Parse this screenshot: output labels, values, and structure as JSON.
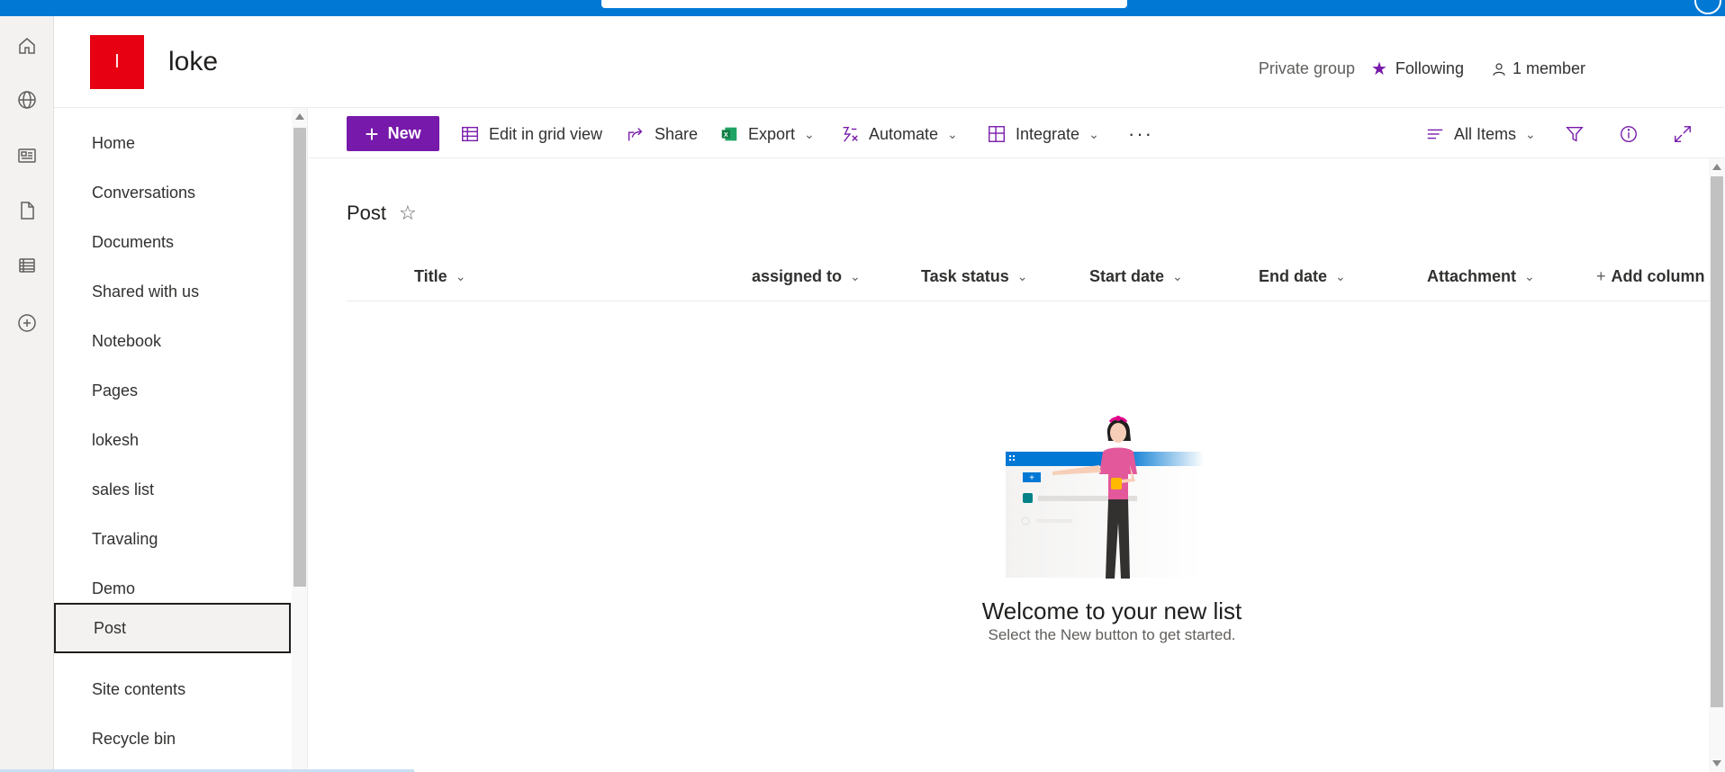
{
  "site": {
    "logo_letter": "l",
    "title": "loke",
    "privacy": "Private group",
    "following_label": "Following",
    "members_label": "1 member"
  },
  "rail": [
    "home-icon",
    "globe-icon",
    "news-icon",
    "document-icon",
    "list-icon",
    "add-circle-icon"
  ],
  "nav": {
    "items": [
      {
        "label": "Home"
      },
      {
        "label": "Conversations"
      },
      {
        "label": "Documents"
      },
      {
        "label": "Shared with us"
      },
      {
        "label": "Notebook"
      },
      {
        "label": "Pages"
      },
      {
        "label": "lokesh"
      },
      {
        "label": "sales list"
      },
      {
        "label": "Travaling"
      },
      {
        "label": "Demo"
      },
      {
        "label": "Post"
      },
      {
        "label": "Site contents"
      },
      {
        "label": "Recycle bin"
      }
    ],
    "selected": "Post"
  },
  "commands": {
    "new_label": "New",
    "edit_grid_label": "Edit in grid view",
    "share_label": "Share",
    "export_label": "Export",
    "automate_label": "Automate",
    "integrate_label": "Integrate",
    "more_label": "···",
    "view_label": "All Items"
  },
  "list": {
    "title": "Post",
    "columns": [
      {
        "label": "Title"
      },
      {
        "label": "assigned to"
      },
      {
        "label": "Task status"
      },
      {
        "label": "Start date"
      },
      {
        "label": "End date"
      },
      {
        "label": "Attachment"
      }
    ],
    "add_column_label": "Add column",
    "empty_title": "Welcome to your new list",
    "empty_subtitle": "Select the New button to get started."
  },
  "colors": {
    "accent": "#7719aa",
    "suite_bar": "#0078d4",
    "logo_bg": "#e60012"
  }
}
